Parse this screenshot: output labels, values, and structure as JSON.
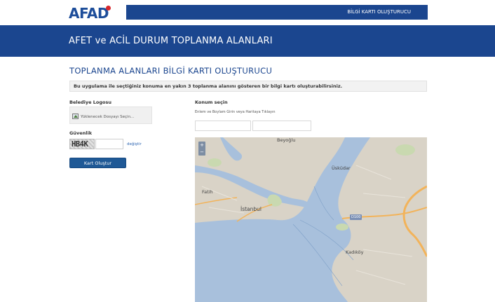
{
  "header": {
    "logo_text": "AFAD",
    "nav_link": "BİLGİ KARTI OLUŞTURUCU",
    "brand_blue": "#1b468f",
    "logo_red": "#d7262b"
  },
  "banner": {
    "title": "AFET ve ACİL DURUM TOPLANMA ALANLARI"
  },
  "main": {
    "title": "TOPLANMA ALANLARI BİLGİ KARTI OLUŞTURUCU",
    "info": "Bu uygulama ile seçtiğiniz konuma en yakın 3 toplanma alanını gösteren bir bilgi kartı oluşturabilirsiniz."
  },
  "form": {
    "logo_label": "Belediye Logosu",
    "upload_text": "Yüklenecek Dosyayı Seçin...",
    "security_label": "Güvenlik",
    "captcha_text": "HB4K",
    "captcha_link": "değiştir",
    "create_button": "Kart Oluştur"
  },
  "location": {
    "label": "Konum seçin",
    "help": "Enlem ve Boylam Girin veya Haritaya Tıklayın"
  },
  "map": {
    "zoom_in": "+",
    "zoom_out": "−",
    "labels": {
      "beyoglu": "Beyoğlu",
      "uskudar": "Üsküdar",
      "fatih": "Fatih",
      "istanbul": "İstanbul",
      "kadikoy": "Kadıköy"
    },
    "road_badge": "D100",
    "colors": {
      "water": "#a8c0dc",
      "land": "#d9d3c7",
      "green": "#c9d9b0",
      "road": "#f2b35a"
    }
  }
}
